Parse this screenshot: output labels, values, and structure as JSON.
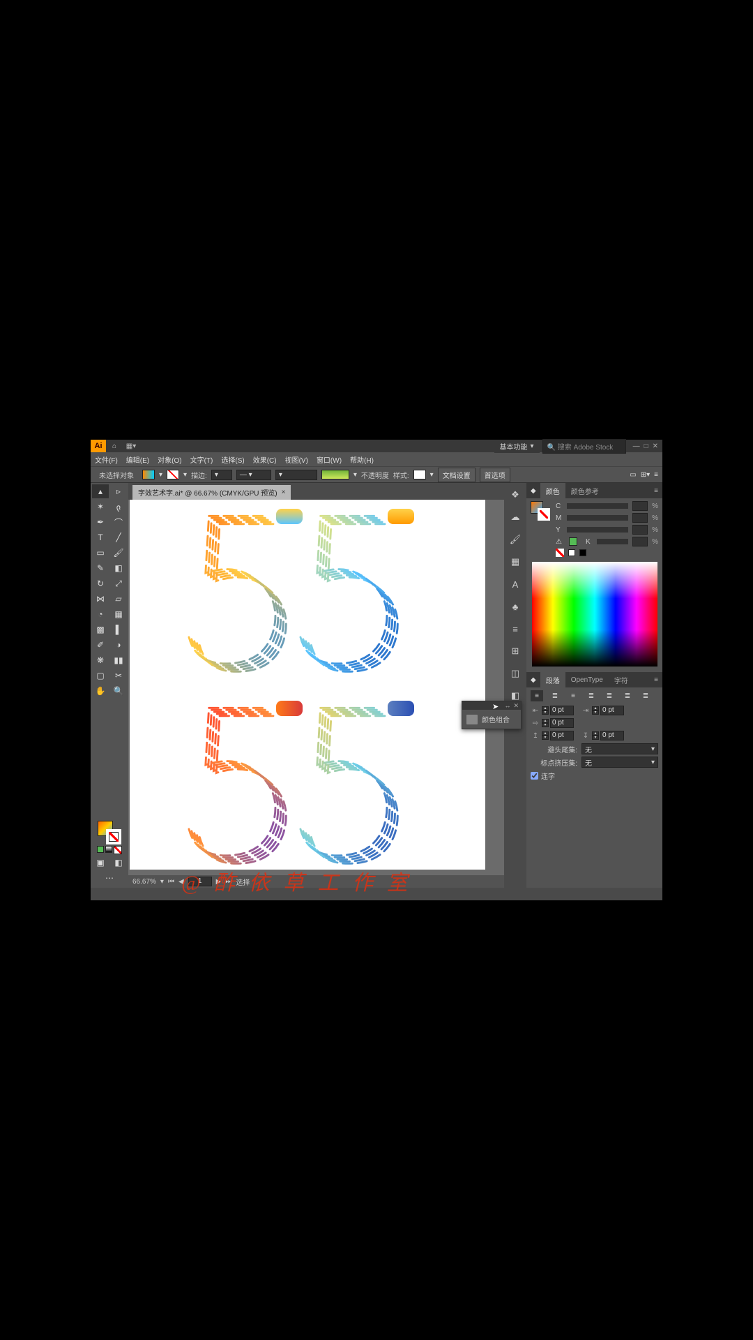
{
  "app": {
    "logo": "Ai"
  },
  "workspace": {
    "label": "基本功能"
  },
  "search": {
    "placeholder": "搜索 Adobe Stock"
  },
  "menu": {
    "file": "文件(F)",
    "edit": "编辑(E)",
    "object": "对象(O)",
    "type": "文字(T)",
    "select": "选择(S)",
    "effect": "效果(C)",
    "view": "视图(V)",
    "window": "窗口(W)",
    "help": "帮助(H)"
  },
  "controlbar": {
    "status": "未选择对象",
    "stroke_label": "描边:",
    "opacity_label": "不透明度",
    "style_label": "样式:",
    "doc_setup": "文档设置",
    "prefs": "首选项"
  },
  "document": {
    "tab_title": "字效艺术字.ai* @ 66.67% (CMYK/GPU 预览)",
    "zoom": "66.67%",
    "page": "1",
    "nav": "选择"
  },
  "floating": {
    "title": "颜色组合"
  },
  "panels": {
    "color": {
      "tab": "颜色",
      "guide_tab": "颜色参考",
      "channels": [
        "C",
        "M",
        "Y",
        "K"
      ]
    },
    "para": {
      "tab": "段落",
      "opentype": "OpenType",
      "char": "字符",
      "indent_left": "0 pt",
      "indent_right": "0 pt",
      "first_line": "0 pt",
      "space_before": "0 pt",
      "space_after": "0 pt",
      "kinsoku_label": "避头尾集:",
      "kinsoku_value": "无",
      "mojikumi_label": "标点挤压集:",
      "mojikumi_value": "无",
      "hyphenate": "连字"
    }
  },
  "watermark": "@ 酢 依 草 工 作 室"
}
